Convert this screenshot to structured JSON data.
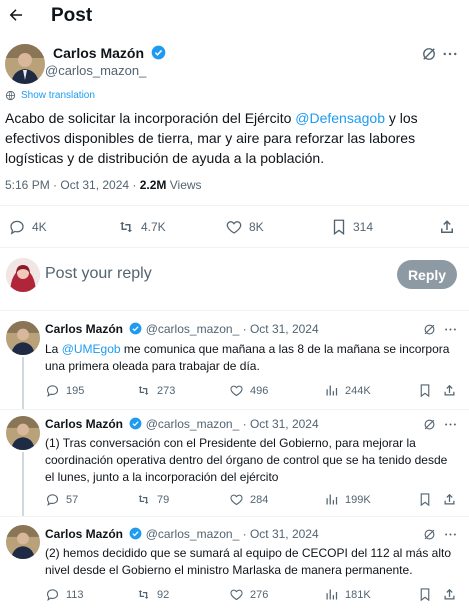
{
  "header": {
    "title": "Post"
  },
  "main_post": {
    "author_name": "Carlos Mazón",
    "handle": "@carlos_mazon_",
    "show_translation": "Show translation",
    "text_part1": "Acabo de solicitar la incorporación del Ejército ",
    "mention": "@Defensagob",
    "text_part2": " y los efectivos disponibles de tierra, mar y aire para reforzar las labores logísticas y de distribución de ayuda a la población.",
    "timestamp": "5:16 PM · Oct 31, 2024 · ",
    "views_count": "2.2M",
    "views_label": " Views",
    "actions": {
      "replies": "4K",
      "reposts": "4.7K",
      "likes": "8K",
      "bookmarks": "314"
    }
  },
  "composer": {
    "placeholder": "Post your reply",
    "reply_button": "Reply"
  },
  "replies": [
    {
      "author_name": "Carlos Mazón",
      "handle": "@carlos_mazon_",
      "date": "· Oct 31, 2024",
      "text_prefix": "La ",
      "mention": "@UMEgob",
      "text": " me comunica que mañana a las 8 de la mañana se incorpora una primera oleada para trabajar de día.",
      "replies": "195",
      "reposts": "273",
      "likes": "496",
      "views": "244K"
    },
    {
      "author_name": "Carlos Mazón",
      "handle": "@carlos_mazon_",
      "date": "· Oct 31, 2024",
      "text": "(1) Tras conversación con el Presidente del Gobierno, para mejorar la coordinación operativa dentro del órgano de control que se ha tenido desde el lunes, junto a la incorporación del ejército",
      "replies": "57",
      "reposts": "79",
      "likes": "284",
      "views": "199K"
    },
    {
      "author_name": "Carlos Mazón",
      "handle": "@carlos_mazon_",
      "date": "· Oct 31, 2024",
      "text": "(2) hemos decidido que se sumará al equipo de CECOPI del 112 al más alto nivel desde el Gobierno el ministro Marlaska de manera permanente.",
      "replies": "113",
      "reposts": "92",
      "likes": "276",
      "views": "181K"
    }
  ],
  "colors": {
    "accent": "#1d9bf0",
    "text": "#0f1419",
    "muted": "#536471",
    "reply_button": "#8e9aa3"
  }
}
